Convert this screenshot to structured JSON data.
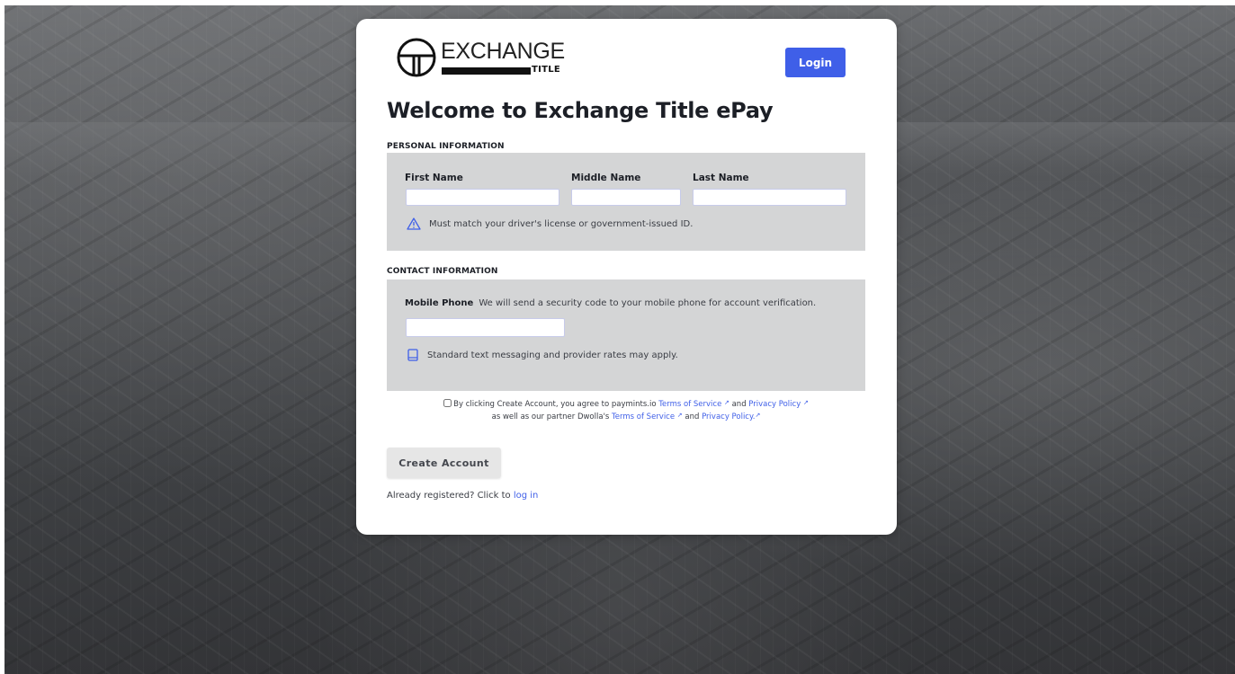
{
  "brand": {
    "word": "EXCHANGE",
    "sub": "TITLE"
  },
  "header": {
    "login_label": "Login"
  },
  "title": "Welcome to Exchange Title ePay",
  "personal": {
    "section_label": "PERSONAL INFORMATION",
    "first_name_label": "First Name",
    "middle_name_label": "Middle Name",
    "last_name_label": "Last Name",
    "first_name_value": "",
    "middle_name_value": "",
    "last_name_value": "",
    "note": "Must match your driver's license or government-issued ID."
  },
  "contact": {
    "section_label": "CONTACT INFORMATION",
    "mobile_label": "Mobile Phone",
    "mobile_desc": "We will send a security code to your mobile phone for account verification.",
    "mobile_value": "",
    "note": "Standard text messaging and provider rates may apply."
  },
  "agreement": {
    "text1": "By clicking Create Account, you agree to paymints.io",
    "tos1": "Terms of Service",
    "and1": "and",
    "privacy1": "Privacy Policy",
    "text2": "as well as our partner Dwolla's",
    "tos2": "Terms of Service",
    "and2": "and",
    "privacy2": "Privacy Policy.",
    "checked": false
  },
  "create_label": "Create Account",
  "already": {
    "text": "Already registered? Click to",
    "link": "log in"
  },
  "colors": {
    "accent": "#3f5fe8",
    "panel": "#d4d5d6",
    "text": "#1c1f26"
  }
}
